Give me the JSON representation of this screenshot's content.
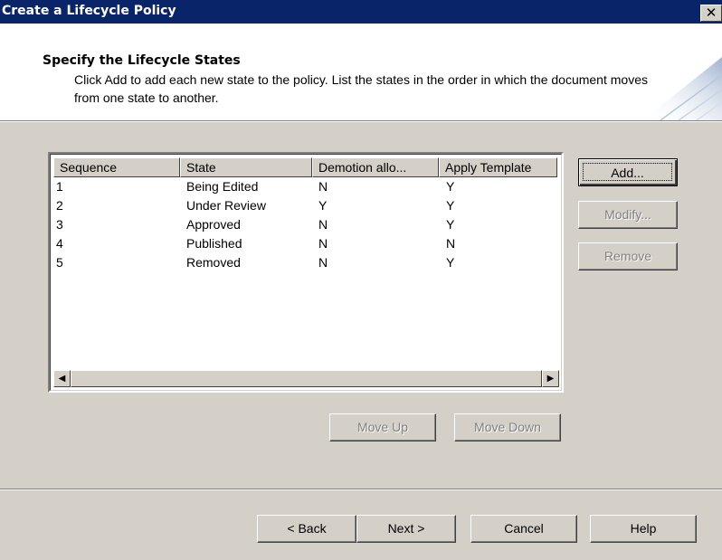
{
  "window": {
    "title": "Create a Lifecycle Policy",
    "close_glyph": "✕"
  },
  "header": {
    "title": "Specify the Lifecycle States",
    "description": "Click Add to add each new state to the policy. List the states in the order in which the document moves from one state to another."
  },
  "table": {
    "columns": [
      "Sequence",
      "State",
      "Demotion allo...",
      "Apply Template"
    ],
    "rows": [
      [
        "1",
        "Being Edited",
        "N",
        "Y"
      ],
      [
        "2",
        "Under Review",
        "Y",
        "Y"
      ],
      [
        "3",
        "Approved",
        "N",
        "Y"
      ],
      [
        "4",
        "Published",
        "N",
        "N"
      ],
      [
        "5",
        "Removed",
        "N",
        "Y"
      ]
    ]
  },
  "scrollbar": {
    "left_arrow": "◀",
    "right_arrow": "▶"
  },
  "side_buttons": {
    "add": {
      "label": "Add...",
      "enabled": true,
      "default": true
    },
    "modify": {
      "label": "Modify...",
      "enabled": false
    },
    "remove": {
      "label": "Remove",
      "enabled": false
    }
  },
  "move_buttons": {
    "move_up": {
      "label": "Move Up",
      "enabled": false
    },
    "move_down": {
      "label": "Move Down",
      "enabled": false
    }
  },
  "footer_buttons": {
    "back": "< Back",
    "next": "Next >",
    "cancel": "Cancel",
    "help": "Help"
  },
  "colors": {
    "titlebar": "#0a246a",
    "dialog_face": "#d4d0c8",
    "header_bg": "#ffffff",
    "disabled_text": "#808080"
  }
}
